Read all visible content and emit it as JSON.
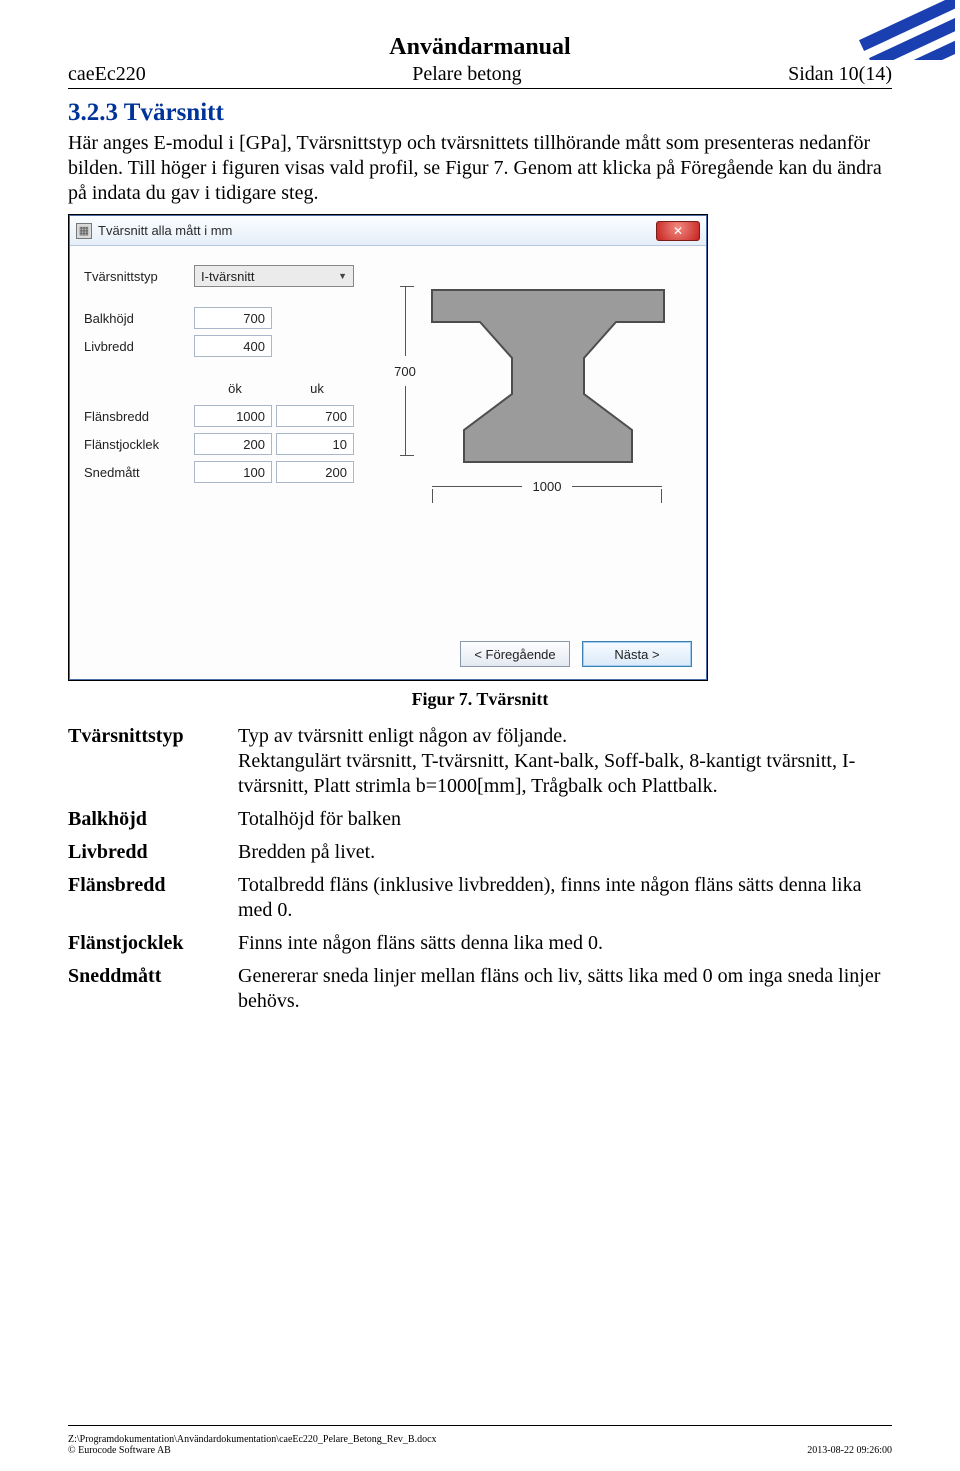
{
  "header": {
    "title": "Användarmanual",
    "left": "caeEc220",
    "center": "Pelare betong",
    "right": "Sidan 10(14)"
  },
  "section": {
    "num_title": "3.2.3  Tvärsnitt",
    "para": "Här anges E-modul i [GPa], Tvärsnittstyp och tvärsnittets tillhörande mått som presenteras nedanför bilden. Till höger i figuren visas vald profil, se Figur 7. Genom att klicka på Föregående kan du ändra på indata du gav i tidigare steg."
  },
  "dialog": {
    "title": "Tvärsnitt alla mått i mm",
    "labels": {
      "Tvarsnittstyp": "Tvärsnittstyp",
      "Balkhojd": "Balkhöjd",
      "Livbredd": "Livbredd",
      "ok": "ök",
      "uk": "uk",
      "Flansbredd": "Flänsbredd",
      "Flanstjocklek": "Flänstjocklek",
      "Snedmatt": "Snedmått"
    },
    "values": {
      "Tvarsnittstyp": "I-tvärsnitt",
      "Balkhojd": "700",
      "Livbredd": "400",
      "Flansbredd_ok": "1000",
      "Flansbredd_uk": "700",
      "Flanstjocklek_ok": "200",
      "Flanstjocklek_uk": "10",
      "Snedmatt_ok": "100",
      "Snedmatt_uk": "200"
    },
    "dims": {
      "height": "700",
      "width": "1000"
    },
    "buttons": {
      "prev": "< Föregående",
      "next": "Nästa >"
    }
  },
  "caption": "Figur 7. Tvärsnitt",
  "defs": {
    "Tvarsnittstyp": {
      "term": "Tvärsnittstyp",
      "desc": "Typ av tvärsnitt enligt någon av följande.\nRektangulärt tvärsnitt, T-tvärsnitt, Kant-balk, Soff-balk, 8-kantigt tvärsnitt, I-tvärsnitt, Platt strimla b=1000[mm], Trågbalk och Plattbalk."
    },
    "Balkhojd": {
      "term": "Balkhöjd",
      "desc": "Totalhöjd för balken"
    },
    "Livbredd": {
      "term": "Livbredd",
      "desc": "Bredden på livet."
    },
    "Flansbredd": {
      "term": "Flänsbredd",
      "desc": "Totalbredd fläns (inklusive livbredden), finns inte någon fläns sätts denna lika med 0."
    },
    "Flanstjocklek": {
      "term": "Flänstjocklek",
      "desc": "Finns inte någon fläns sätts denna lika med 0."
    },
    "Sneddmatt": {
      "term": "Sneddmått",
      "desc": "Genererar sneda linjer mellan fläns och liv, sätts lika med 0 om inga sneda linjer behövs."
    }
  },
  "footer": {
    "path": "Z:\\Programdokumentation\\Användardokumentation\\caeEc220_Pelare_Betong_Rev_B.docx",
    "copyright": "© Eurocode Software AB",
    "timestamp": "2013-08-22 09:26:00"
  }
}
